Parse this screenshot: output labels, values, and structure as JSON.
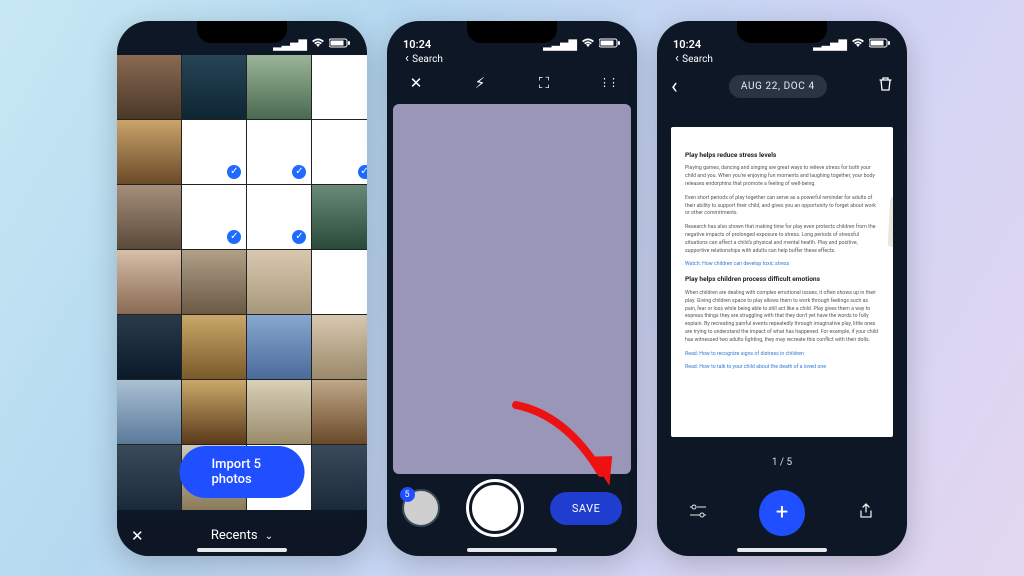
{
  "status": {
    "time": "10:24",
    "back_label": "Search",
    "signal_glyph": "▂▃▅▇",
    "wifi_glyph": "✶",
    "battery_glyph": "▮▯"
  },
  "phone1": {
    "import_label": "Import 5 photos",
    "album_label": "Recents",
    "close_glyph": "✕",
    "chevron_glyph": "⌄",
    "selected_count": 5,
    "check_glyph": "✓",
    "thumbs": [
      {
        "cls": "c1"
      },
      {
        "cls": "c2"
      },
      {
        "cls": "c3"
      },
      {
        "cls": "c4"
      },
      {
        "cls": "c5"
      },
      {
        "cls": "c6",
        "selected": true
      },
      {
        "cls": "c7",
        "selected": true
      },
      {
        "cls": "c8",
        "selected": true
      },
      {
        "cls": "c9"
      },
      {
        "cls": "c10",
        "selected": true
      },
      {
        "cls": "c11",
        "selected": true
      },
      {
        "cls": "c12"
      },
      {
        "cls": "c13"
      },
      {
        "cls": "c14"
      },
      {
        "cls": "c15"
      },
      {
        "cls": "c16"
      },
      {
        "cls": "c17"
      },
      {
        "cls": "c18"
      },
      {
        "cls": "c19"
      },
      {
        "cls": "c20"
      },
      {
        "cls": "c21"
      },
      {
        "cls": "c22"
      },
      {
        "cls": "c23"
      },
      {
        "cls": "c24"
      },
      {
        "cls": "c25"
      },
      {
        "cls": "c26"
      },
      {
        "cls": "c27"
      },
      {
        "cls": "c28"
      }
    ]
  },
  "phone2": {
    "close_glyph": "✕",
    "flash_glyph": "⚡︎",
    "expand_glyph": "⛶",
    "settings_glyph": "⋮⋮",
    "stack_count": "5",
    "save_label": "SAVE"
  },
  "phone3": {
    "back_glyph": "‹",
    "title_label": "AUG 22, DOC 4",
    "trash_glyph": "🗑",
    "pager_label": "1 / 5",
    "filters_glyph": "⊟",
    "fab_glyph": "+",
    "share_glyph": "⇪",
    "doc": {
      "h1": "Play helps reduce stress levels",
      "p1": "Playing games, dancing and singing are great ways to relieve stress for both your child and you. When you're enjoying fun moments and laughing together, your body releases endorphins that promote a feeling of well-being.",
      "p2": "Even short periods of play together can serve as a powerful reminder for adults of their ability to support their child, and gives you an opportunity to forget about work or other commitments.",
      "p3": "Research has also shown that making time for play even protects children from the negative impacts of prolonged exposure to stress. Long periods of stressful situations can affect a child's physical and mental health. Play and positive, supportive relationships with adults can help buffer these effects.",
      "link1": "Watch: How children can develop toxic stress",
      "h2": "Play helps children process difficult emotions",
      "p4": "When children are dealing with complex emotional issues, it often shows up in their play. Giving children space to play allows them to work through feelings such as pain, fear or loss while being able to still act like a child. Play gives them a way to express things they are struggling with that they don't yet have the words to fully explain. By recreating painful events repeatedly through imaginative play, little ones are trying to understand the impact of what has happened. For example, if your child has witnessed two adults fighting, they may recreate this conflict with their dolls.",
      "link2": "Read: How to recognize signs of distress in children",
      "link3": "Read: How to talk to your child about the death of a loved one"
    }
  }
}
